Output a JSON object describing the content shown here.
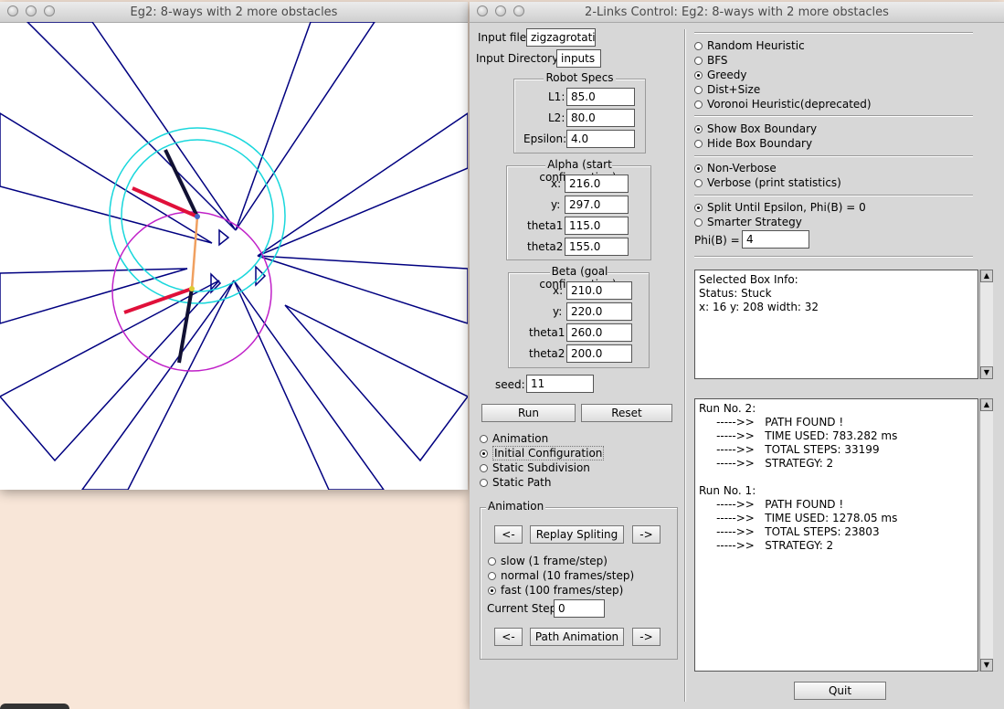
{
  "canvas_window": {
    "title": "Eg2: 8-ways with 2 more obstacles"
  },
  "control_window": {
    "title": "2-Links Control: Eg2: 8-ways with 2 more obstacles",
    "input_file_label": "Input file:",
    "input_file_value": "zigzagrotati",
    "input_dir_label": "Input Directory:",
    "input_dir_value": "inputs",
    "robot_specs": {
      "title": "Robot Specs",
      "l1_label": "L1:",
      "l1_value": "85.0",
      "l2_label": "L2:",
      "l2_value": "80.0",
      "eps_label": "Epsilon:",
      "eps_value": "4.0"
    },
    "alpha": {
      "title": "Alpha (start configuration)",
      "x_label": "x:",
      "x_value": "216.0",
      "y_label": "y:",
      "y_value": "297.0",
      "t1_label": "theta1",
      "t1_value": "115.0",
      "t2_label": "theta2",
      "t2_value": "155.0"
    },
    "beta": {
      "title": "Beta (goal configuration)",
      "x_label": "x:",
      "x_value": "210.0",
      "y_label": "y:",
      "y_value": "220.0",
      "t1_label": "theta1",
      "t1_value": "260.0",
      "t2_label": "theta2",
      "t2_value": "200.0"
    },
    "seed_label": "seed:",
    "seed_value": "11",
    "run_button": "Run",
    "reset_button": "Reset",
    "view_modes": {
      "animation": "Animation",
      "initial": "Initial Configuration",
      "subdivision": "Static Subdivision",
      "path": "Static Path",
      "selected": "initial"
    },
    "animation_group": {
      "title": "Animation",
      "prev": "<-",
      "replay": "Replay Spliting",
      "next": "->",
      "slow": "slow (1 frame/step)",
      "normal": "normal (10 frames/step)",
      "fast": "fast (100 frames/step)",
      "speed_selected": "fast",
      "current_step_label": "Current Step",
      "current_step_value": "0",
      "prev2": "<-",
      "path_anim": "Path Animation",
      "next2": "->"
    },
    "heuristics": {
      "random": "Random Heuristic",
      "bfs": "BFS",
      "greedy": "Greedy",
      "dist": "Dist+Size",
      "voronoi": "Voronoi Heuristic(deprecated)",
      "selected": "greedy"
    },
    "boundary": {
      "show": "Show Box Boundary",
      "hide": "Hide Box Boundary",
      "selected": "show"
    },
    "verbosity": {
      "non": "Non-Verbose",
      "verbose": "Verbose (print statistics)",
      "selected": "non"
    },
    "strategy": {
      "split": "Split Until Epsilon, Phi(B) = 0",
      "smarter": "Smarter Strategy",
      "selected": "split",
      "phi_label": "Phi(B) =",
      "phi_value": "4"
    },
    "box_info": "Selected Box Info:\nStatus: Stuck\nx: 16 y: 208 width: 32",
    "run_log": "Run No. 2:\n     ----->>   PATH FOUND !\n     ----->>   TIME USED: 783.282 ms\n     ----->>   TOTAL STEPS: 33199\n     ----->>   STRATEGY: 2\n\nRun No. 1:\n     ----->>   PATH FOUND !\n     ----->>   TIME USED: 1278.05 ms\n     ----->>   TOTAL STEPS: 23803\n     ----->>   STRATEGY: 2",
    "quit_button": "Quit"
  },
  "colors": {
    "obstacle": "#000080",
    "start_link1": "#111133",
    "goal_link": "#e0103a",
    "circle_start": "#19d7dc",
    "circle_goal": "#c020c8",
    "connector": "#f0a060"
  }
}
